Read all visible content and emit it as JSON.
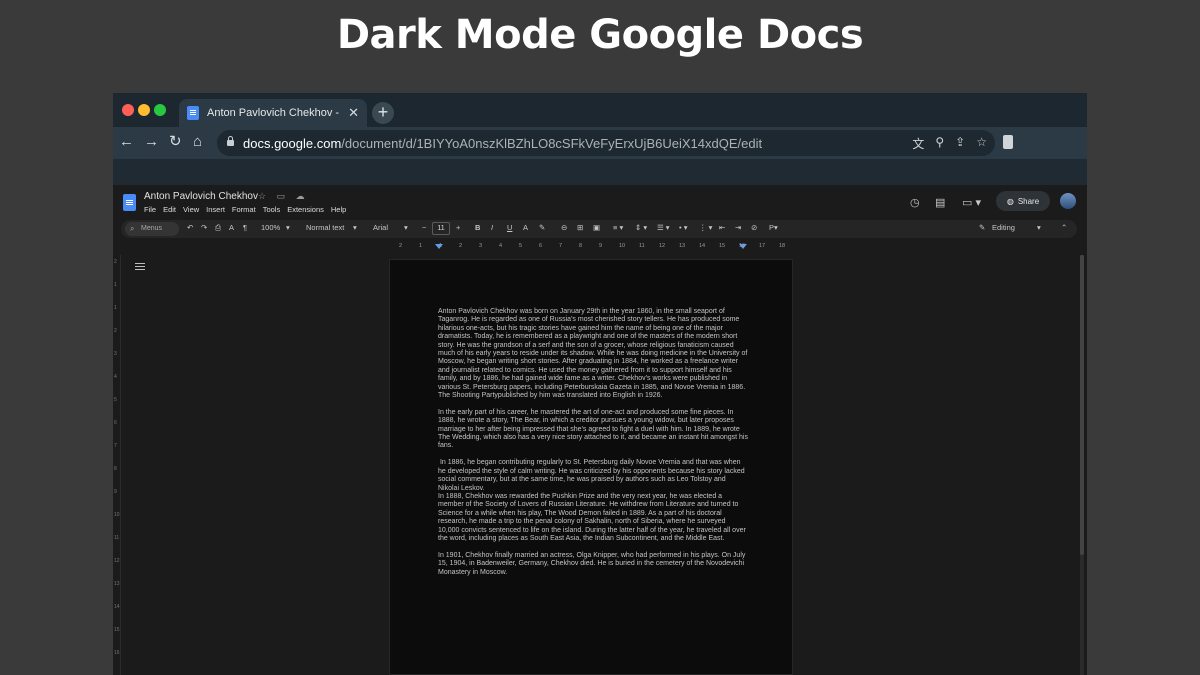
{
  "headline": "Dark Mode Google Docs",
  "browser": {
    "tab_title": "Anton Pavlovich Chekhov - Go",
    "tab_close": "✕",
    "new_tab": "+",
    "url_host": "docs.google.com",
    "url_path": "/document/d/1BIYYoA0nszKlBZhLO8cSFkVeFyErxUjB6UeiX14xdQE/edit",
    "nav": {
      "back": "←",
      "forward": "→",
      "reload": "↻",
      "home": "⌂"
    },
    "omnibox_icons": {
      "translate": "文",
      "zoom": "⚲",
      "share": "⇪",
      "bookmark": "☆"
    }
  },
  "docs": {
    "title": "Anton Pavlovich Chekhov",
    "title_icons": "☆ ▭ ☁",
    "menu": [
      "File",
      "Edit",
      "View",
      "Insert",
      "Format",
      "Tools",
      "Extensions",
      "Help"
    ],
    "header_icons": {
      "history": "◷",
      "comments": "▤",
      "meet": "▭ ▾"
    },
    "share": "Share",
    "toolbar": {
      "menus": "Menus",
      "undo": "↶",
      "redo": "↷",
      "print": "⎙",
      "spellcheck": "A",
      "paint": "¶",
      "zoom": "100%",
      "style": "Normal text",
      "font": "Arial",
      "minus": "−",
      "font_size": "11",
      "plus": "+",
      "bold": "B",
      "italic": "I",
      "underline": "U",
      "textcolor": "A",
      "highlight": "✎",
      "link": "⊖",
      "comment": "⊞",
      "image": "▣",
      "align": "≡ ▾",
      "spacing": "⇕ ▾",
      "checklist": "☰ ▾",
      "bullets": "• ▾",
      "numbers": "⋮ ▾",
      "indent_less": "⇤",
      "indent_more": "⇥",
      "clear": "⊘",
      "editing": "Editing",
      "collapse": "⌃"
    },
    "ruler": [
      "2",
      "1",
      "1",
      "2",
      "3",
      "4",
      "5",
      "6",
      "7",
      "8",
      "9",
      "10",
      "11",
      "12",
      "13",
      "14",
      "15",
      "16",
      "17",
      "18"
    ],
    "vruler": [
      "2",
      "1",
      "1",
      "2",
      "3",
      "4",
      "5",
      "6",
      "7",
      "8",
      "9",
      "10",
      "11",
      "12",
      "13",
      "14",
      "15",
      "16"
    ],
    "paragraphs": [
      "Anton Pavlovich Chekhov was born on January 29th in the year 1860, in the small seaport of Taganrog. He is regarded as one of Russia's most cherished story tellers. He has produced some hilarious one-acts, but his tragic stories have gained him the name of being one of the major dramatists. Today, he is remembered as a playwright and one of the masters of the modern short story. He was the grandson of a serf and the son of a grocer, whose religious fanaticism caused much of his early years to reside under its shadow. While he was doing medicine in the University of Moscow, he began writing short stories. After graduating in 1884, he worked as a freelance writer and journalist related to comics. He used the money gathered from it to support himself and his family, and by 1886, he had gained wide fame as a writer. Chekhov's works were published in various St. Petersburg papers, including Peterburskaia Gazeta in 1885, and Novoe Vremia in 1886. The Shooting Partypublished by him was translated into English in 1926.",
      "In the early part of his career, he mastered the art of one-act and produced some fine pieces. In 1888, he wrote a story, The Bear, in which a creditor pursues a young widow, but later proposes marriage to her after being impressed that she's agreed to fight a duel with him. In 1889, he wrote The Wedding, which also has a very nice story attached to it, and became an instant hit amongst his fans.",
      " In 1886, he began contributing regularly to St. Petersburg daily Novoe Vremia and that was when he developed the style of calm writing. He was criticized by his opponents because his story lacked social commentary, but at the same time, he was praised by authors such as Leo Tolstoy and Nikolai Leskov.",
      "In 1888, Chekhov was rewarded the Pushkin Prize and the very next year, he was elected a member of the Society of Lovers of Russian Literature.  He withdrew from Literature and turned to Science for a while when his play, The Wood Demon failed in 1889. As a part of his doctoral research, he made a trip to the penal colony of Sakhalin, north of Siberia, where he surveyed 10,000 convicts sentenced to life on the island. During the latter half of the year, he traveled all over the word, including places as South East Asia, the Indian Subcontinent, and the Middle East.",
      "In 1901, Chekhov finally married an actress, Olga Knipper, who had performed in his plays. On July 15, 1904, in Badenweiler, Germany, Chekhov died. He is buried in the cemetery of the Novodevichi Monastery in Moscow."
    ]
  }
}
